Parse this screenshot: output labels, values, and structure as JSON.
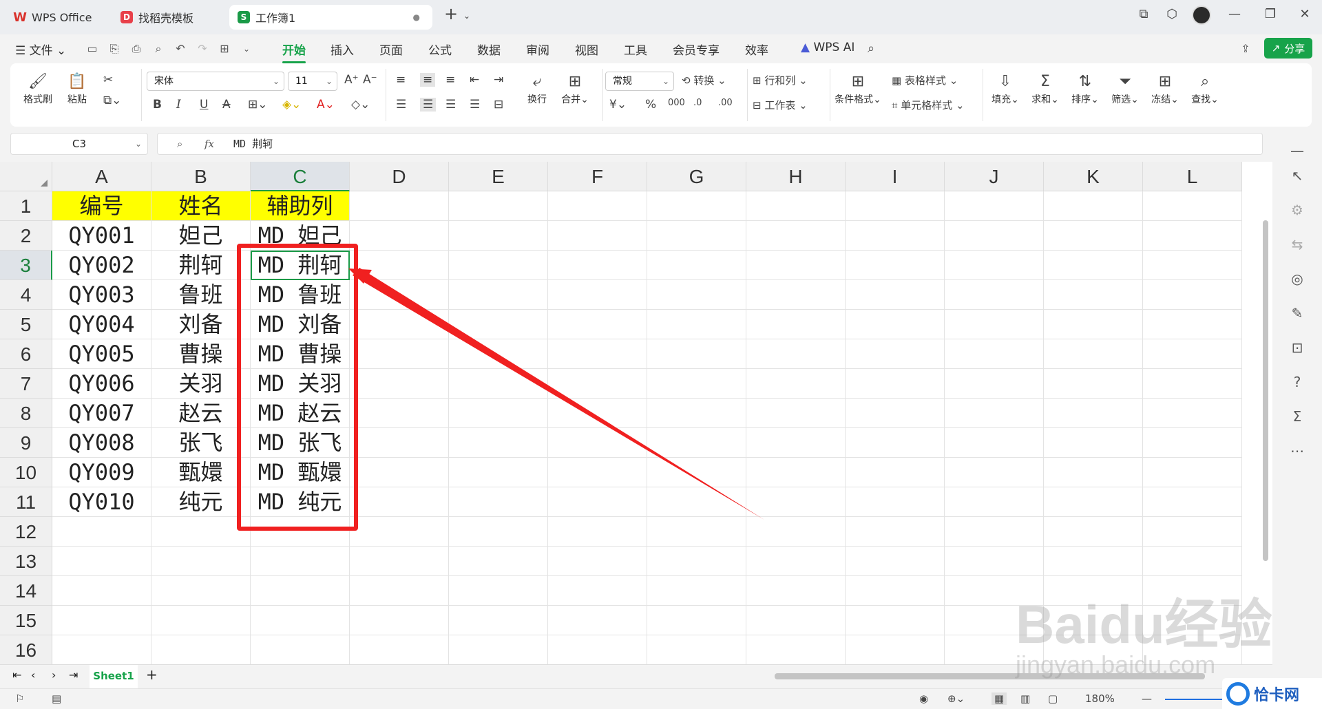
{
  "tabs": [
    {
      "label": "WPS Office",
      "icon": "wps-logo-icon",
      "color": "#d9312b"
    },
    {
      "label": "找稻壳模板",
      "icon": "docer-icon",
      "color": "#e8404a"
    },
    {
      "label": "工作簿1",
      "icon": "spreadsheet-icon",
      "color": "#1a9a47",
      "active": true
    }
  ],
  "menu": {
    "file_label": "文件",
    "items": [
      "开始",
      "插入",
      "页面",
      "公式",
      "数据",
      "审阅",
      "视图",
      "工具",
      "会员专享",
      "效率"
    ],
    "active": "开始",
    "wps_ai": "WPS AI",
    "share": "分享"
  },
  "ribbon": {
    "format_painter": "格式刷",
    "paste": "粘贴",
    "font_name": "宋体",
    "font_size": "11",
    "wrap": "换行",
    "merge": "合并",
    "number_format": "常规",
    "convert": "转换",
    "row_col": "行和列",
    "worksheet": "工作表",
    "cond_format": "条件格式",
    "table_style": "表格样式",
    "cell_style": "单元格样式",
    "fill": "填充",
    "sum": "求和",
    "sort": "排序",
    "filter": "筛选",
    "freeze": "冻结",
    "find": "查找"
  },
  "formula_bar": {
    "cell_ref": "C3",
    "fx": "fx",
    "value": "MD 荆轲"
  },
  "grid": {
    "columns": [
      "A",
      "B",
      "C",
      "D",
      "E",
      "F",
      "G",
      "H",
      "I",
      "J",
      "K",
      "L"
    ],
    "rows": [
      "1",
      "2",
      "3",
      "4",
      "5",
      "6",
      "7",
      "8",
      "9",
      "10",
      "11",
      "12",
      "13",
      "14",
      "15",
      "16"
    ],
    "selected_column": "C",
    "selected_row": "3",
    "header": [
      "编号",
      "姓名",
      "辅助列"
    ],
    "data": [
      [
        "QY001",
        "妲己",
        "MD 妲己"
      ],
      [
        "QY002",
        "荆轲",
        "MD 荆轲"
      ],
      [
        "QY003",
        "鲁班",
        "MD 鲁班"
      ],
      [
        "QY004",
        "刘备",
        "MD 刘备"
      ],
      [
        "QY005",
        "曹操",
        "MD 曹操"
      ],
      [
        "QY006",
        "关羽",
        "MD 关羽"
      ],
      [
        "QY007",
        "赵云",
        "MD 赵云"
      ],
      [
        "QY008",
        "张飞",
        "MD 张飞"
      ],
      [
        "QY009",
        "甄嬛",
        "MD 甄嬛"
      ],
      [
        "QY010",
        "纯元",
        "MD 纯元"
      ]
    ]
  },
  "sheet": {
    "name": "Sheet1",
    "add": "+"
  },
  "status": {
    "zoom": "180%"
  },
  "watermark": {
    "brand": "Baidu经验",
    "url": "jingyan.baidu.com",
    "badge": "恰卡网"
  },
  "colors": {
    "accent": "#17a34a",
    "header_fill": "#ffff00",
    "annotation": "#f02020"
  }
}
